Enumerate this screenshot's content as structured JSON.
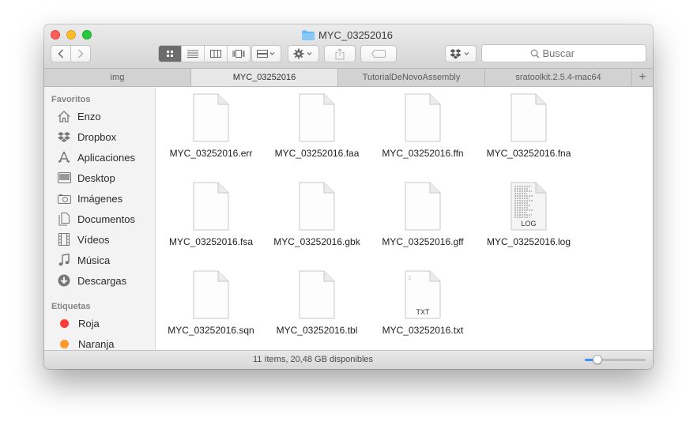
{
  "window": {
    "title": "MYC_03252016",
    "title_icon": "folder-icon"
  },
  "toolbar": {
    "back_icon": "chevron-left-icon",
    "forward_icon": "chevron-right-icon",
    "view_modes": [
      "icon-view",
      "list-view",
      "column-view",
      "cover-flow-view"
    ],
    "active_view": "icon-view",
    "arrange_icon": "arrange-grid-icon",
    "action_icon": "gear-icon",
    "share_icon": "share-icon",
    "tags_icon": "tag-icon",
    "dropbox_icon": "dropbox-icon",
    "search_placeholder": "Buscar"
  },
  "tabs": [
    {
      "label": "img",
      "active": false
    },
    {
      "label": "MYC_03252016",
      "active": true
    },
    {
      "label": "TutorialDeNovoAssembly",
      "active": false
    },
    {
      "label": "sratoolkit.2.5.4-mac64",
      "active": false
    }
  ],
  "sidebar": {
    "favorites_header": "Favoritos",
    "favorites": [
      {
        "label": "Enzo",
        "icon": "home-icon"
      },
      {
        "label": "Dropbox",
        "icon": "dropbox-icon"
      },
      {
        "label": "Aplicaciones",
        "icon": "applications-icon"
      },
      {
        "label": "Desktop",
        "icon": "desktop-icon"
      },
      {
        "label": "Imágenes",
        "icon": "camera-icon"
      },
      {
        "label": "Documentos",
        "icon": "documents-icon"
      },
      {
        "label": "Vídeos",
        "icon": "film-icon"
      },
      {
        "label": "Música",
        "icon": "music-note-icon"
      },
      {
        "label": "Descargas",
        "icon": "download-icon"
      }
    ],
    "tags_header": "Etiquetas",
    "tags": [
      {
        "label": "Roja",
        "color": "#fc3d39"
      },
      {
        "label": "Naranja",
        "color": "#fd9a2a"
      }
    ]
  },
  "files": [
    {
      "name": "MYC_03252016.err",
      "icon": "blank-document-icon"
    },
    {
      "name": "MYC_03252016.faa",
      "icon": "blank-document-icon"
    },
    {
      "name": "MYC_03252016.ffn",
      "icon": "blank-document-icon"
    },
    {
      "name": "MYC_03252016.fna",
      "icon": "blank-document-icon"
    },
    {
      "name": "MYC_03252016.fsa",
      "icon": "blank-document-icon"
    },
    {
      "name": "MYC_03252016.gbk",
      "icon": "blank-document-icon"
    },
    {
      "name": "MYC_03252016.gff",
      "icon": "blank-document-icon"
    },
    {
      "name": "MYC_03252016.log",
      "icon": "log-document-icon",
      "badge": "LOG"
    },
    {
      "name": "MYC_03252016.sqn",
      "icon": "blank-document-icon"
    },
    {
      "name": "MYC_03252016.tbl",
      "icon": "blank-document-icon"
    },
    {
      "name": "MYC_03252016.txt",
      "icon": "text-document-icon",
      "badge": "TXT"
    }
  ],
  "status": {
    "text": "11 ítems, 20,48 GB disponibles",
    "icon_size_level": 0.15
  }
}
